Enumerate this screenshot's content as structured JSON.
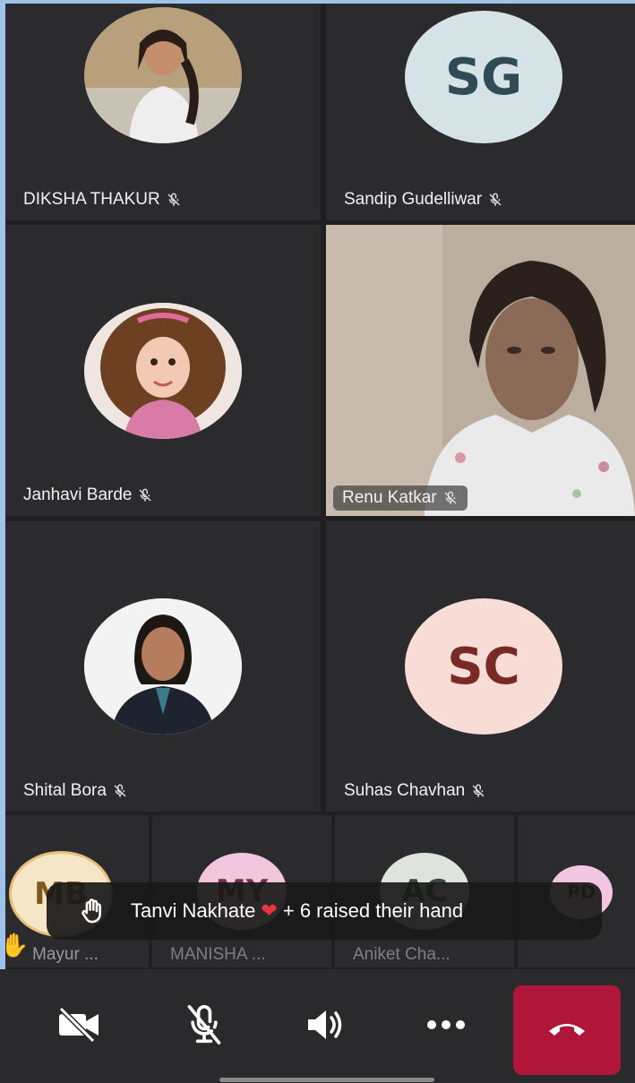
{
  "participants": [
    {
      "name": "DIKSHA THAKUR",
      "mic_muted": true
    },
    {
      "name": "Sandip Gudelliwar",
      "initials": "SG",
      "mic_muted": true
    },
    {
      "name": "Janhavi Barde",
      "mic_muted": true
    },
    {
      "name": "Renu Katkar",
      "mic_muted": true
    },
    {
      "name": "Shital Bora",
      "mic_muted": true
    },
    {
      "name": "Suhas Chavhan",
      "initials": "SC",
      "mic_muted": true
    }
  ],
  "strip": [
    {
      "name": "Mayur ...",
      "initials": "MB"
    },
    {
      "name": "MANISHA ...",
      "initials": "MY"
    },
    {
      "name": "Aniket Cha...",
      "initials": "AC"
    },
    {
      "initials": "PD"
    }
  ],
  "toast": {
    "name": "Tanvi Nakhate",
    "suffix": "+ 6 raised their hand"
  },
  "colors": {
    "sg_bg": "#d5e3e6",
    "sg_fg": "#2f4b56",
    "sc_bg": "#f7ddd6",
    "sc_fg": "#7a2a24",
    "mb_bg": "#f6e6c8",
    "my_bg": "#f2c6dc",
    "ac_bg": "#dfe3de",
    "pd_bg": "#f2c6e0",
    "end_call": "#b0163a"
  },
  "icons": [
    "mic-off-icon",
    "raised-hand-icon",
    "heart-icon",
    "camera-off-icon",
    "mic-off-icon",
    "speaker-icon",
    "more-icon",
    "end-call-icon"
  ]
}
